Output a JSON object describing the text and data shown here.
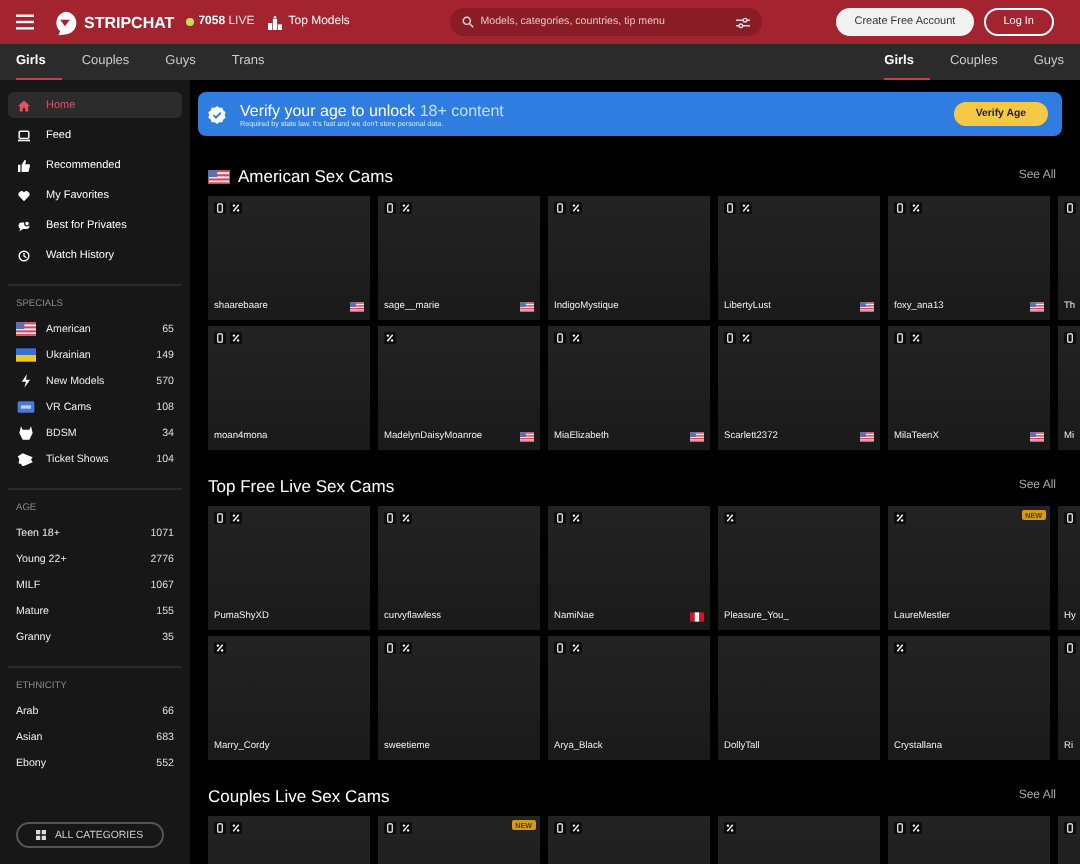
{
  "header": {
    "brand": "STRIPCHAT",
    "live_count": "7058",
    "live_label": "LIVE",
    "top_models": "Top Models",
    "search": {
      "placeholder": "Models, categories, countries, tip menu"
    },
    "buttons": [
      {
        "label": "Create Free Account",
        "kind": "primary"
      },
      {
        "label": "Log In",
        "kind": "outline"
      }
    ]
  },
  "nav_left": [
    {
      "label": "Girls",
      "selected": true
    },
    {
      "label": "Couples",
      "selected": false
    },
    {
      "label": "Guys",
      "selected": false
    },
    {
      "label": "Trans",
      "selected": false
    }
  ],
  "nav_right": [
    {
      "label": "Girls",
      "selected": true
    },
    {
      "label": "Couples",
      "selected": false
    },
    {
      "label": "Guys",
      "selected": false
    }
  ],
  "sidebar": {
    "items": [
      {
        "label": "Home",
        "kind": "home",
        "selected": true
      },
      {
        "label": "Feed",
        "kind": "feed",
        "selected": false
      },
      {
        "label": "Recommended",
        "kind": "thumb",
        "selected": false
      },
      {
        "label": "My Favorites",
        "kind": "heart",
        "selected": false
      },
      {
        "label": "Best for Privates",
        "kind": "chat",
        "selected": false
      },
      {
        "label": "Watch History",
        "kind": "clock",
        "selected": false
      }
    ],
    "sections": [
      {
        "title": "SPECIALS",
        "items": [
          {
            "label": "American",
            "count": "65",
            "kind": "flagus"
          },
          {
            "label": "Ukrainian",
            "count": "149",
            "kind": "flagua"
          },
          {
            "label": "New Models",
            "count": "570",
            "kind": "bolt"
          },
          {
            "label": "VR Cams",
            "count": "108",
            "kind": "vr"
          },
          {
            "label": "BDSM",
            "count": "34",
            "kind": "mask"
          },
          {
            "label": "Ticket Shows",
            "count": "104",
            "kind": "ticket"
          }
        ]
      },
      {
        "title": "AGE",
        "items": [
          {
            "label": "Teen 18+",
            "count": "1071"
          },
          {
            "label": "Young 22+",
            "count": "2776"
          },
          {
            "label": "MILF",
            "count": "1067"
          },
          {
            "label": "Mature",
            "count": "155"
          },
          {
            "label": "Granny",
            "count": "35"
          }
        ]
      },
      {
        "title": "ETHNICITY",
        "items": [
          {
            "label": "Arab",
            "count": "66"
          },
          {
            "label": "Asian",
            "count": "683"
          },
          {
            "label": "Ebony",
            "count": "552"
          }
        ]
      }
    ],
    "all_categories": "ALL CATEGORIES"
  },
  "banner": {
    "title": "Verify your age to unlock",
    "highlight": "18+ content",
    "subtitle": "Required by state law. It's fast and we don't store personal data.",
    "button": "Verify Age"
  },
  "sections": [
    {
      "title": "American Sex Cams",
      "kind": "flagged",
      "see_all": "See All",
      "rows": [
        [
          {
            "name": "shaarebaare",
            "mobile": true,
            "percent": true,
            "kind": "us"
          },
          {
            "name": "sage__marie",
            "mobile": true,
            "percent": true,
            "kind": "us"
          },
          {
            "name": "IndigoMystique",
            "mobile": true,
            "percent": true
          },
          {
            "name": "LibertyLust",
            "mobile": true,
            "percent": true,
            "kind": "us"
          },
          {
            "name": "foxy_ana13",
            "mobile": true,
            "percent": true,
            "kind": "us"
          },
          {
            "name": "Th",
            "mobile": true
          }
        ],
        [
          {
            "name": "moan4mona",
            "mobile": true,
            "percent": true
          },
          {
            "name": "MadelynDaisyMoanroe",
            "mobile": false,
            "percent": true,
            "kind": "us"
          },
          {
            "name": "MiaElizabeth",
            "mobile": true,
            "percent": true,
            "kind": "us"
          },
          {
            "name": "Scarlett2372",
            "mobile": true,
            "percent": true,
            "kind": "us"
          },
          {
            "name": "MilaTeenX",
            "mobile": true,
            "percent": true,
            "kind": "us"
          },
          {
            "name": "Mi",
            "mobile": true
          }
        ]
      ]
    },
    {
      "title": "Top Free Live Sex Cams",
      "see_all": "See All",
      "rows": [
        [
          {
            "name": "PumaShyXD",
            "mobile": true,
            "percent": true
          },
          {
            "name": "curvyflawless",
            "mobile": true,
            "percent": true
          },
          {
            "name": "NamiNae",
            "mobile": true,
            "percent": true,
            "kind": "pe"
          },
          {
            "name": "Pleasure_You_",
            "mobile": false,
            "percent": true
          },
          {
            "name": "LaureMestler",
            "mobile": false,
            "percent": true,
            "badge": "NEW"
          },
          {
            "name": "Hy",
            "mobile": true
          }
        ],
        [
          {
            "name": "Marry_Cordy",
            "mobile": false,
            "percent": true
          },
          {
            "name": "sweetieme",
            "mobile": true,
            "percent": true
          },
          {
            "name": "Arya_Black",
            "mobile": true,
            "percent": true
          },
          {
            "name": "DollyTall",
            "mobile": false
          },
          {
            "name": "Crystallana",
            "mobile": false,
            "percent": true
          },
          {
            "name": "Ri",
            "mobile": true
          }
        ]
      ]
    },
    {
      "title": "Couples Live Sex Cams",
      "see_all": "See All",
      "rows": [
        [
          {
            "mobile": true,
            "percent": true
          },
          {
            "mobile": true,
            "percent": true,
            "badge": "NEW"
          },
          {
            "mobile": true,
            "percent": true
          },
          {
            "mobile": false,
            "percent": true
          },
          {
            "mobile": true,
            "percent": true
          },
          {
            "mobile": true
          }
        ]
      ]
    }
  ]
}
